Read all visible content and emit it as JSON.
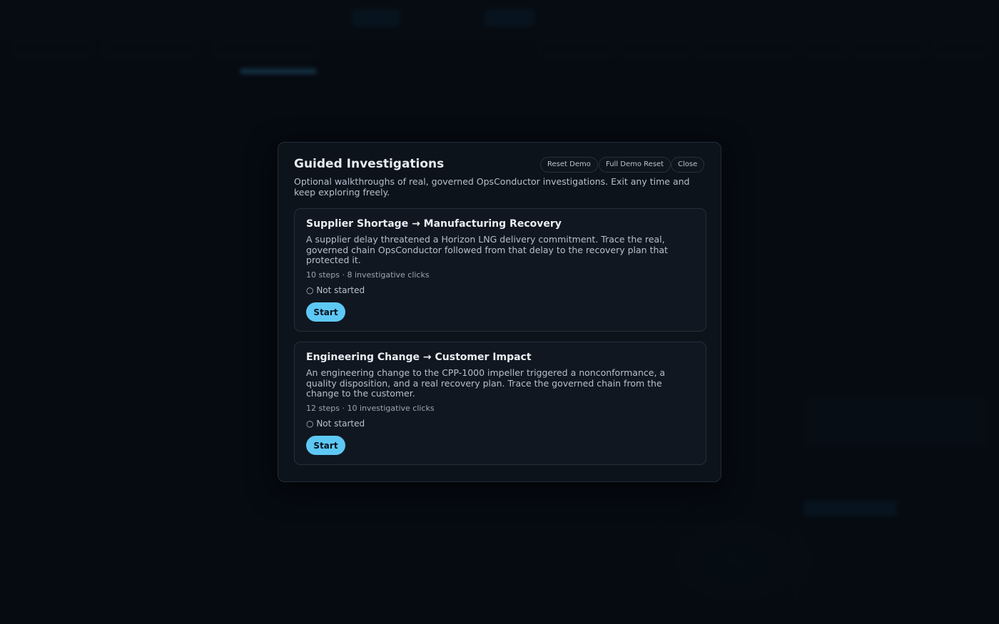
{
  "modal": {
    "title": "Guided Investigations",
    "subtitle": "Optional walkthroughs of real, governed OpsConductor investigations. Exit any time and keep exploring freely.",
    "reset_demo_label": "Reset Demo",
    "full_reset_label": "Full Demo Reset",
    "close_label": "Close"
  },
  "investigations": [
    {
      "title": "Supplier Shortage → Manufacturing Recovery",
      "description": "A supplier delay threatened a Horizon LNG delivery commitment. Trace the real, governed chain OpsConductor followed from that delay to the recovery plan that protected it.",
      "meta": "10 steps · 8 investigative clicks",
      "status_icon": "○",
      "status": "Not started",
      "start_label": "Start"
    },
    {
      "title": "Engineering Change → Customer Impact",
      "description": "An engineering change to the CPP-1000 impeller triggered a nonconformance, a quality disposition, and a real recovery plan. Trace the governed chain from the change to the customer.",
      "meta": "12 steps · 10 investigative clicks",
      "status_icon": "○",
      "status": "Not started",
      "start_label": "Start"
    }
  ],
  "colors": {
    "accent": "#5ec8f5",
    "background": "#0a0f17",
    "modal_bg": "#0d131b"
  }
}
